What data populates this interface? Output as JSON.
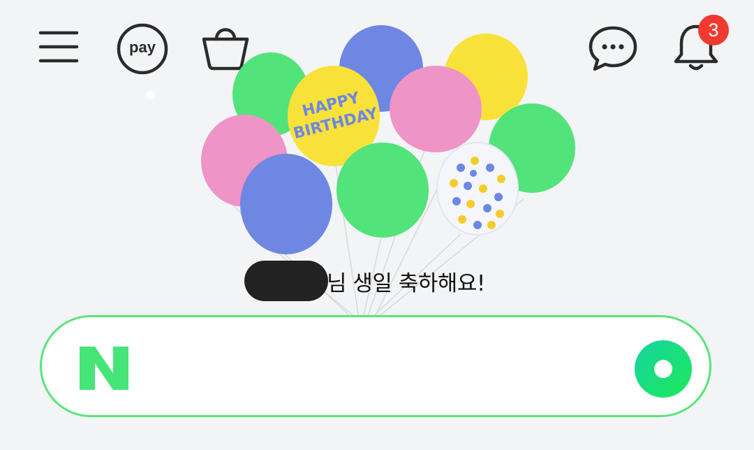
{
  "header": {
    "menu_icon": "hamburger-menu-icon",
    "pay_label": "pay",
    "bag_icon": "shopping-bag-icon",
    "chat_icon": "chat-bubble-icon",
    "bell_icon": "bell-icon",
    "notification_count": "3"
  },
  "banner": {
    "greeting": "님 생일 축하해요!",
    "balloon_text_line1": "HAPPY",
    "balloon_text_line2": "BIRTHDAY"
  },
  "search": {
    "logo_icon": "naver-n-logo-icon",
    "lens_icon": "green-lens-icon",
    "placeholder": "",
    "value": ""
  },
  "colors": {
    "brand_green": "#03c75a",
    "search_border": "#5ae47a",
    "badge_red": "#f03a2f",
    "background": "#f3f4f6"
  }
}
